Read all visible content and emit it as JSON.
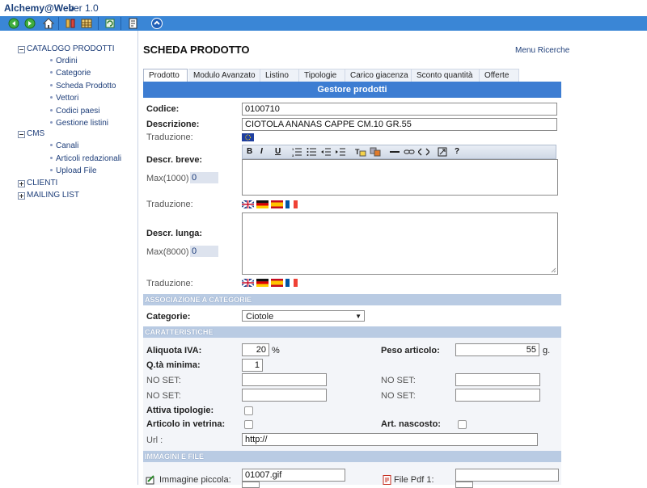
{
  "app": {
    "name": "Alchemy@Web",
    "version": "ver 1.0"
  },
  "toolbar": {
    "icons": [
      "back-icon",
      "forward-icon",
      "home-icon",
      "tools-icon",
      "grid-icon",
      "refresh-icon",
      "export-icon",
      "info-icon"
    ]
  },
  "sidebar": {
    "groups": [
      {
        "label": "CATALOGO PRODOTTI",
        "expanded": true,
        "items": [
          "Ordini",
          "Categorie",
          "Scheda Prodotto",
          "Vettori",
          "Codici paesi",
          "Gestione listini"
        ]
      },
      {
        "label": "CMS",
        "expanded": true,
        "items": [
          "Canali",
          "Articoli redazionali",
          "Upload File"
        ]
      },
      {
        "label": "CLIENTI",
        "expanded": false,
        "items": []
      },
      {
        "label": "MAILING LIST",
        "expanded": false,
        "items": []
      }
    ]
  },
  "page": {
    "title": "SCHEDA PRODOTTO",
    "menu_link": "Menu Ricerche"
  },
  "tabs": [
    "Prodotto",
    "Modulo Avanzato",
    "Listino",
    "Tipologie",
    "Carico giacenza",
    "Sconto quantità",
    "Offerte"
  ],
  "active_tab": "Prodotto",
  "panel_title": "Gestore prodotti",
  "form": {
    "codice_label": "Codice:",
    "codice_value": "0100710",
    "descrizione_label": "Descrizione:",
    "descrizione_value": "CIOTOLA ANANAS CAPPE CM.10 GR.55",
    "traduzione_label": "Traduzione:",
    "descr_breve_label": "Descr. breve:",
    "max_breve_label": "Max(1000)",
    "max_breve_value": "0",
    "descr_lunga_label": "Descr. lunga:",
    "max_lunga_label": "Max(8000)",
    "max_lunga_value": "0",
    "editor_buttons": [
      "B",
      "I",
      "U",
      "ordered-list-icon",
      "unordered-list-icon",
      "outdent-icon",
      "indent-icon",
      "text-color-icon",
      "highlight-icon",
      "hr-icon",
      "link-icon",
      "code-icon",
      "fullscreen-icon",
      "?"
    ]
  },
  "sections": {
    "categorie": "ASSOCIAZIONE A CATEGORIE",
    "caratteristiche": "CARATTERISTICHE",
    "immagini": "IMMAGINI E FILE"
  },
  "categorie": {
    "label": "Categorie:",
    "selected": "Ciotole"
  },
  "caratteristiche": {
    "iva_label": "Aliquota IVA:",
    "iva_value": "20",
    "iva_unit": "%",
    "peso_label": "Peso articolo:",
    "peso_value": "55",
    "peso_unit": "g.",
    "qta_label": "Q.tà minima:",
    "qta_value": "1",
    "noset_label": "NO SET:",
    "tipologie_label": "Attiva tipologie:",
    "vetrina_label": "Articolo in vetrina:",
    "nascosto_label": "Art. nascosto:",
    "url_label": "Url :",
    "url_value": "http://"
  },
  "immagini": {
    "img_piccola_label": "Immagine piccola:",
    "img_piccola_value": "01007.gif",
    "pdf_label": "File Pdf 1:"
  },
  "colors": {
    "toolbar": "#3a86d6",
    "header_bar": "#3d7dd2",
    "section_bar": "#b9cbe3",
    "link": "#1f3f7a"
  }
}
